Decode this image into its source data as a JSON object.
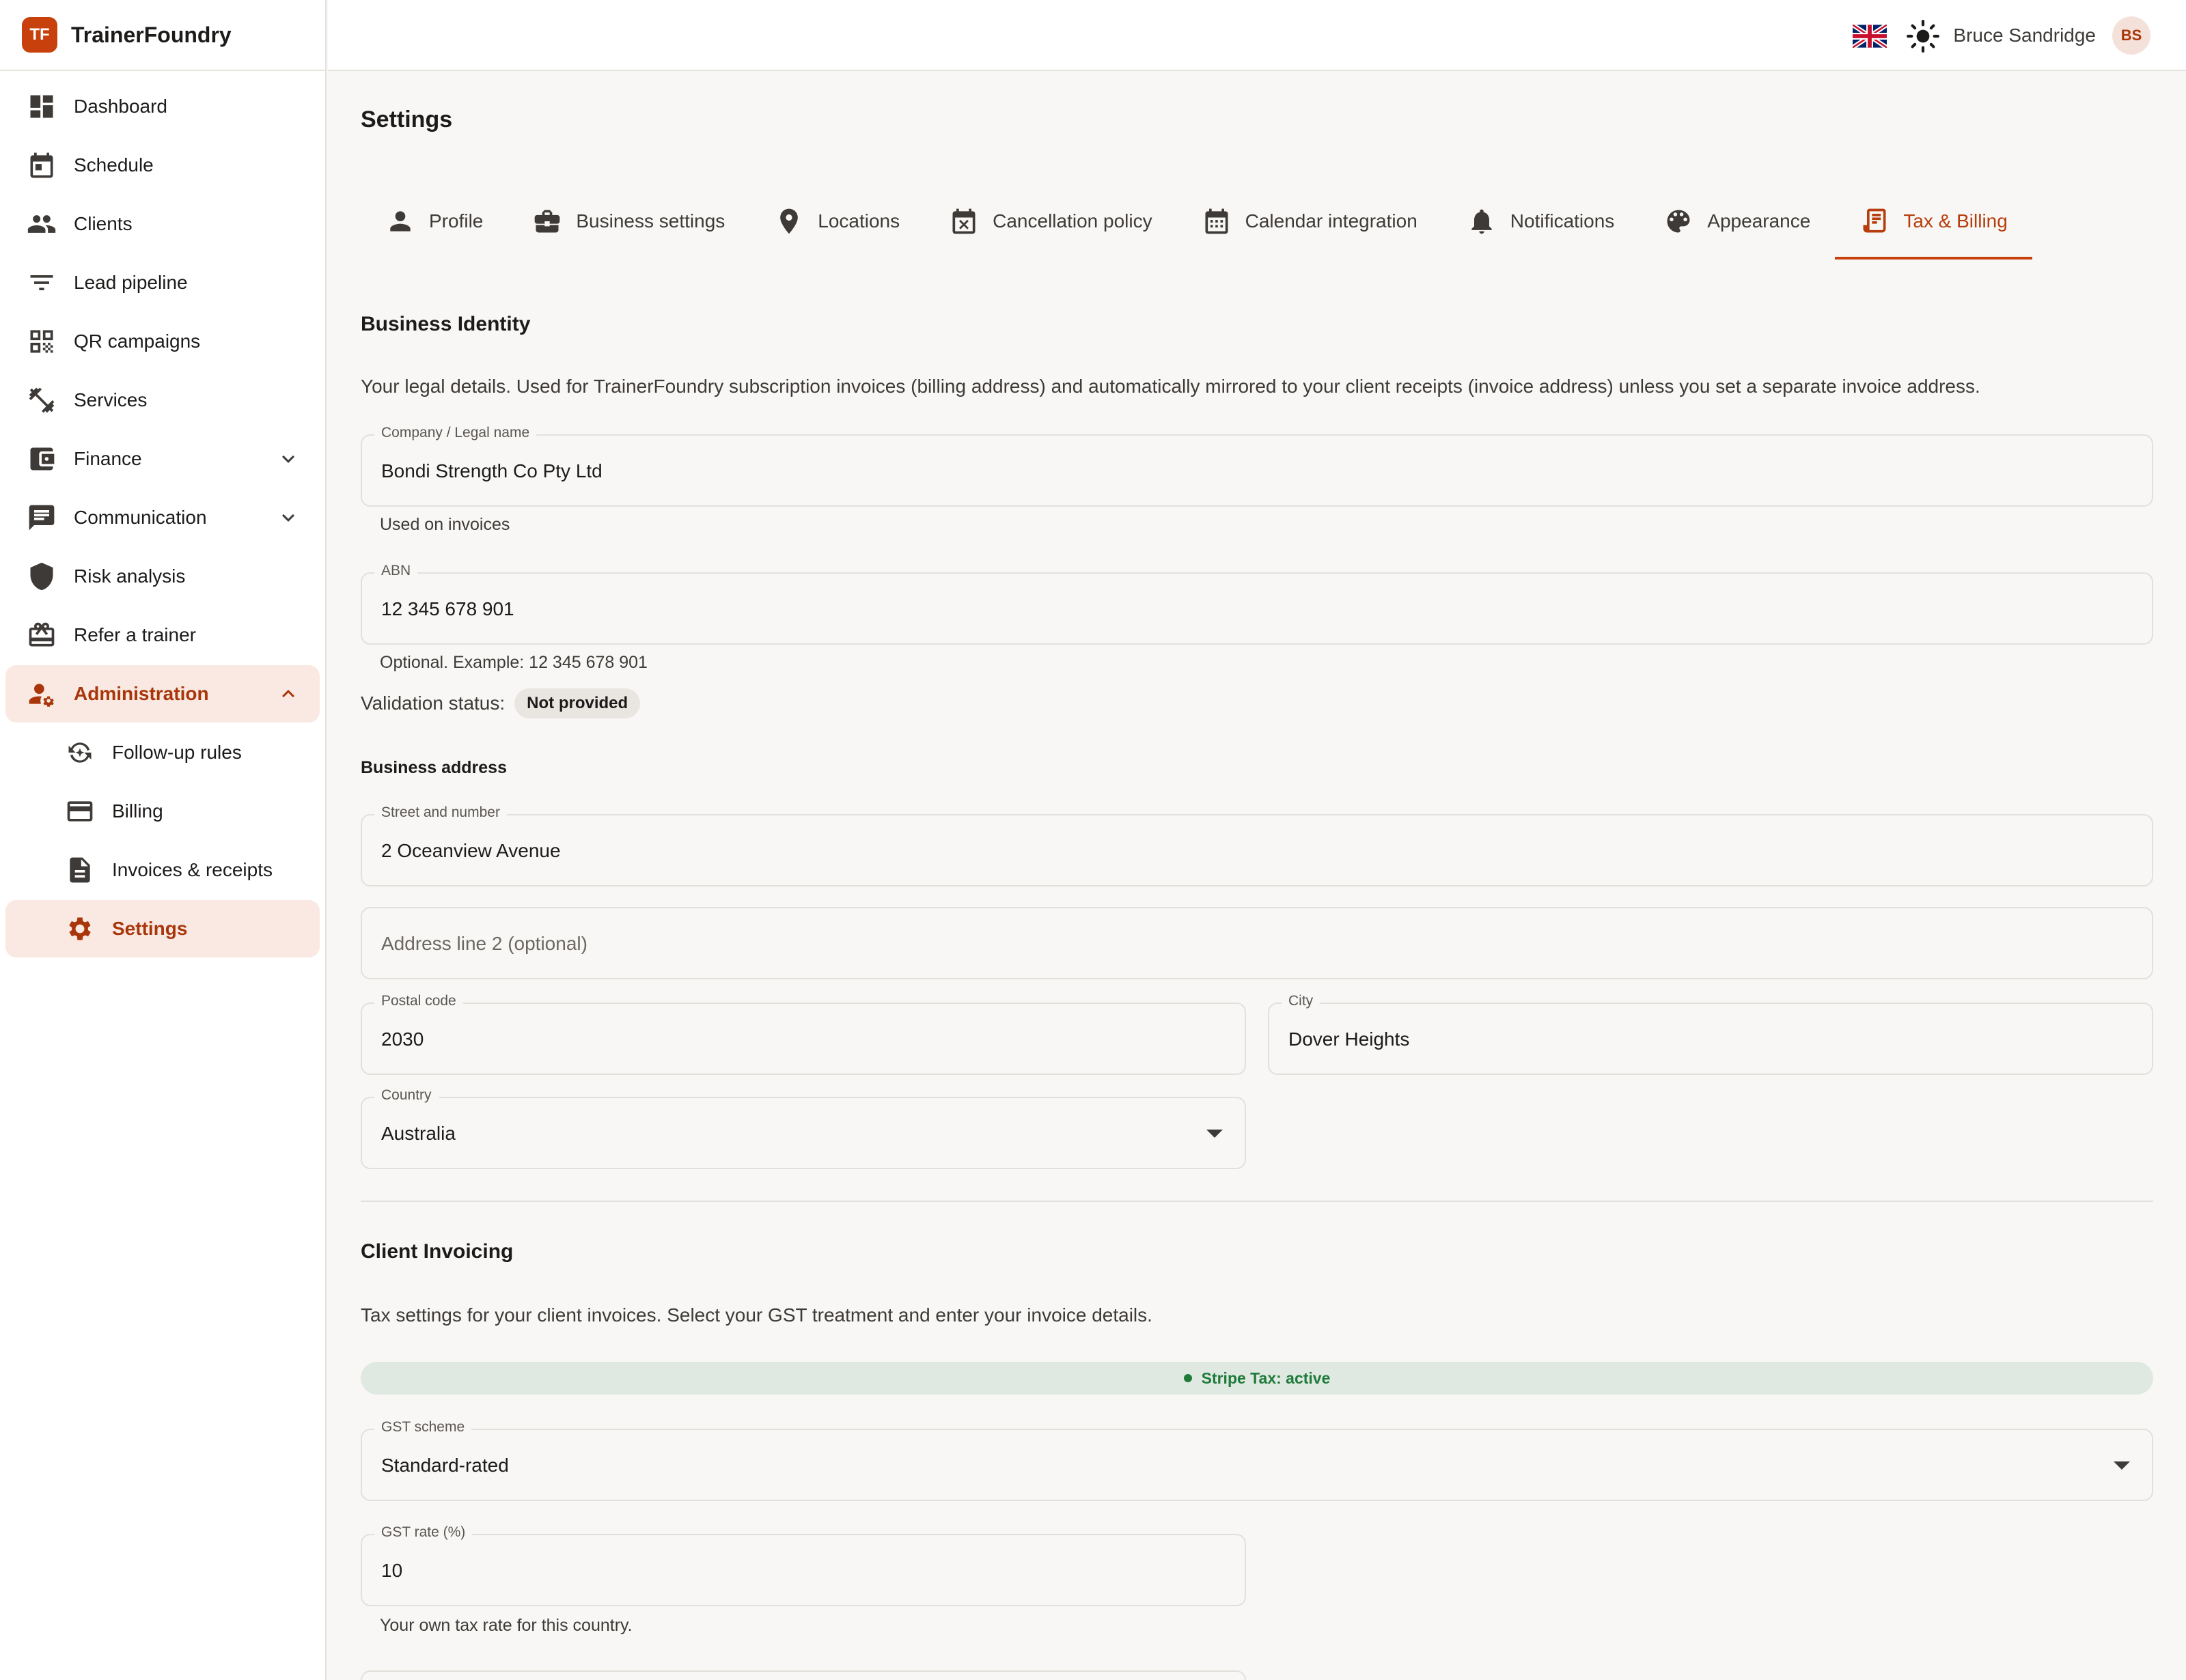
{
  "brand": {
    "logo": "TF",
    "name": "TrainerFoundry"
  },
  "topbar": {
    "user_name": "Bruce Sandridge",
    "avatar_initials": "BS",
    "flag_icon": "uk-flag-icon",
    "theme_icon": "sun-icon"
  },
  "sidebar": {
    "items": [
      {
        "label": "Dashboard",
        "icon": "dashboard-icon"
      },
      {
        "label": "Schedule",
        "icon": "calendar-icon"
      },
      {
        "label": "Clients",
        "icon": "people-icon"
      },
      {
        "label": "Lead pipeline",
        "icon": "filter-icon"
      },
      {
        "label": "QR campaigns",
        "icon": "qr-icon"
      },
      {
        "label": "Services",
        "icon": "dumbbell-icon"
      },
      {
        "label": "Finance",
        "icon": "wallet-icon"
      },
      {
        "label": "Communication",
        "icon": "chat-icon"
      },
      {
        "label": "Risk analysis",
        "icon": "shield-icon"
      },
      {
        "label": "Refer a trainer",
        "icon": "gift-icon"
      },
      {
        "label": "Administration",
        "icon": "admin-icon"
      },
      {
        "label": "Follow-up rules",
        "icon": "followup-icon"
      },
      {
        "label": "Billing",
        "icon": "credit-card-icon"
      },
      {
        "label": "Invoices & receipts",
        "icon": "document-icon"
      },
      {
        "label": "Settings",
        "icon": "gear-icon"
      }
    ]
  },
  "page": {
    "title": "Settings"
  },
  "tabs": [
    {
      "label": "Profile",
      "icon": "person-icon"
    },
    {
      "label": "Business settings",
      "icon": "briefcase-icon"
    },
    {
      "label": "Locations",
      "icon": "pin-icon"
    },
    {
      "label": "Cancellation policy",
      "icon": "calendar-x-icon"
    },
    {
      "label": "Calendar integration",
      "icon": "calendar-grid-icon"
    },
    {
      "label": "Notifications",
      "icon": "bell-icon"
    },
    {
      "label": "Appearance",
      "icon": "palette-icon"
    },
    {
      "label": "Tax & Billing",
      "icon": "receipt-icon"
    }
  ],
  "identity": {
    "title": "Business Identity",
    "description": "Your legal details. Used for TrainerFoundry subscription invoices (billing address) and automatically mirrored to your client receipts (invoice address) unless you set a separate invoice address.",
    "company_label": "Company / Legal name",
    "company_value": "Bondi Strength Co Pty Ltd",
    "company_helper": "Used on invoices",
    "abn_label": "ABN",
    "abn_value": "12 345 678 901",
    "abn_helper": "Optional. Example: 12 345 678 901",
    "validation_label": "Validation status:",
    "validation_badge": "Not provided",
    "address_heading": "Business address",
    "street_label": "Street and number",
    "street_value": "2 Oceanview Avenue",
    "address2_placeholder": "Address line 2 (optional)",
    "postal_label": "Postal code",
    "postal_value": "2030",
    "city_label": "City",
    "city_value": "Dover Heights",
    "country_label": "Country",
    "country_value": "Australia"
  },
  "invoicing": {
    "title": "Client Invoicing",
    "description": "Tax settings for your client invoices. Select your GST treatment and enter your invoice details.",
    "stripe_status": "Stripe Tax: active",
    "gst_scheme_label": "GST scheme",
    "gst_scheme_value": "Standard-rated",
    "gst_rate_label": "GST rate (%)",
    "gst_rate_value": "10",
    "gst_rate_helper": "Your own tax rate for this country."
  },
  "colors": {
    "accent": "#c8410c",
    "active_bg": "#f9e9e2",
    "success": "#1f7a3a"
  }
}
